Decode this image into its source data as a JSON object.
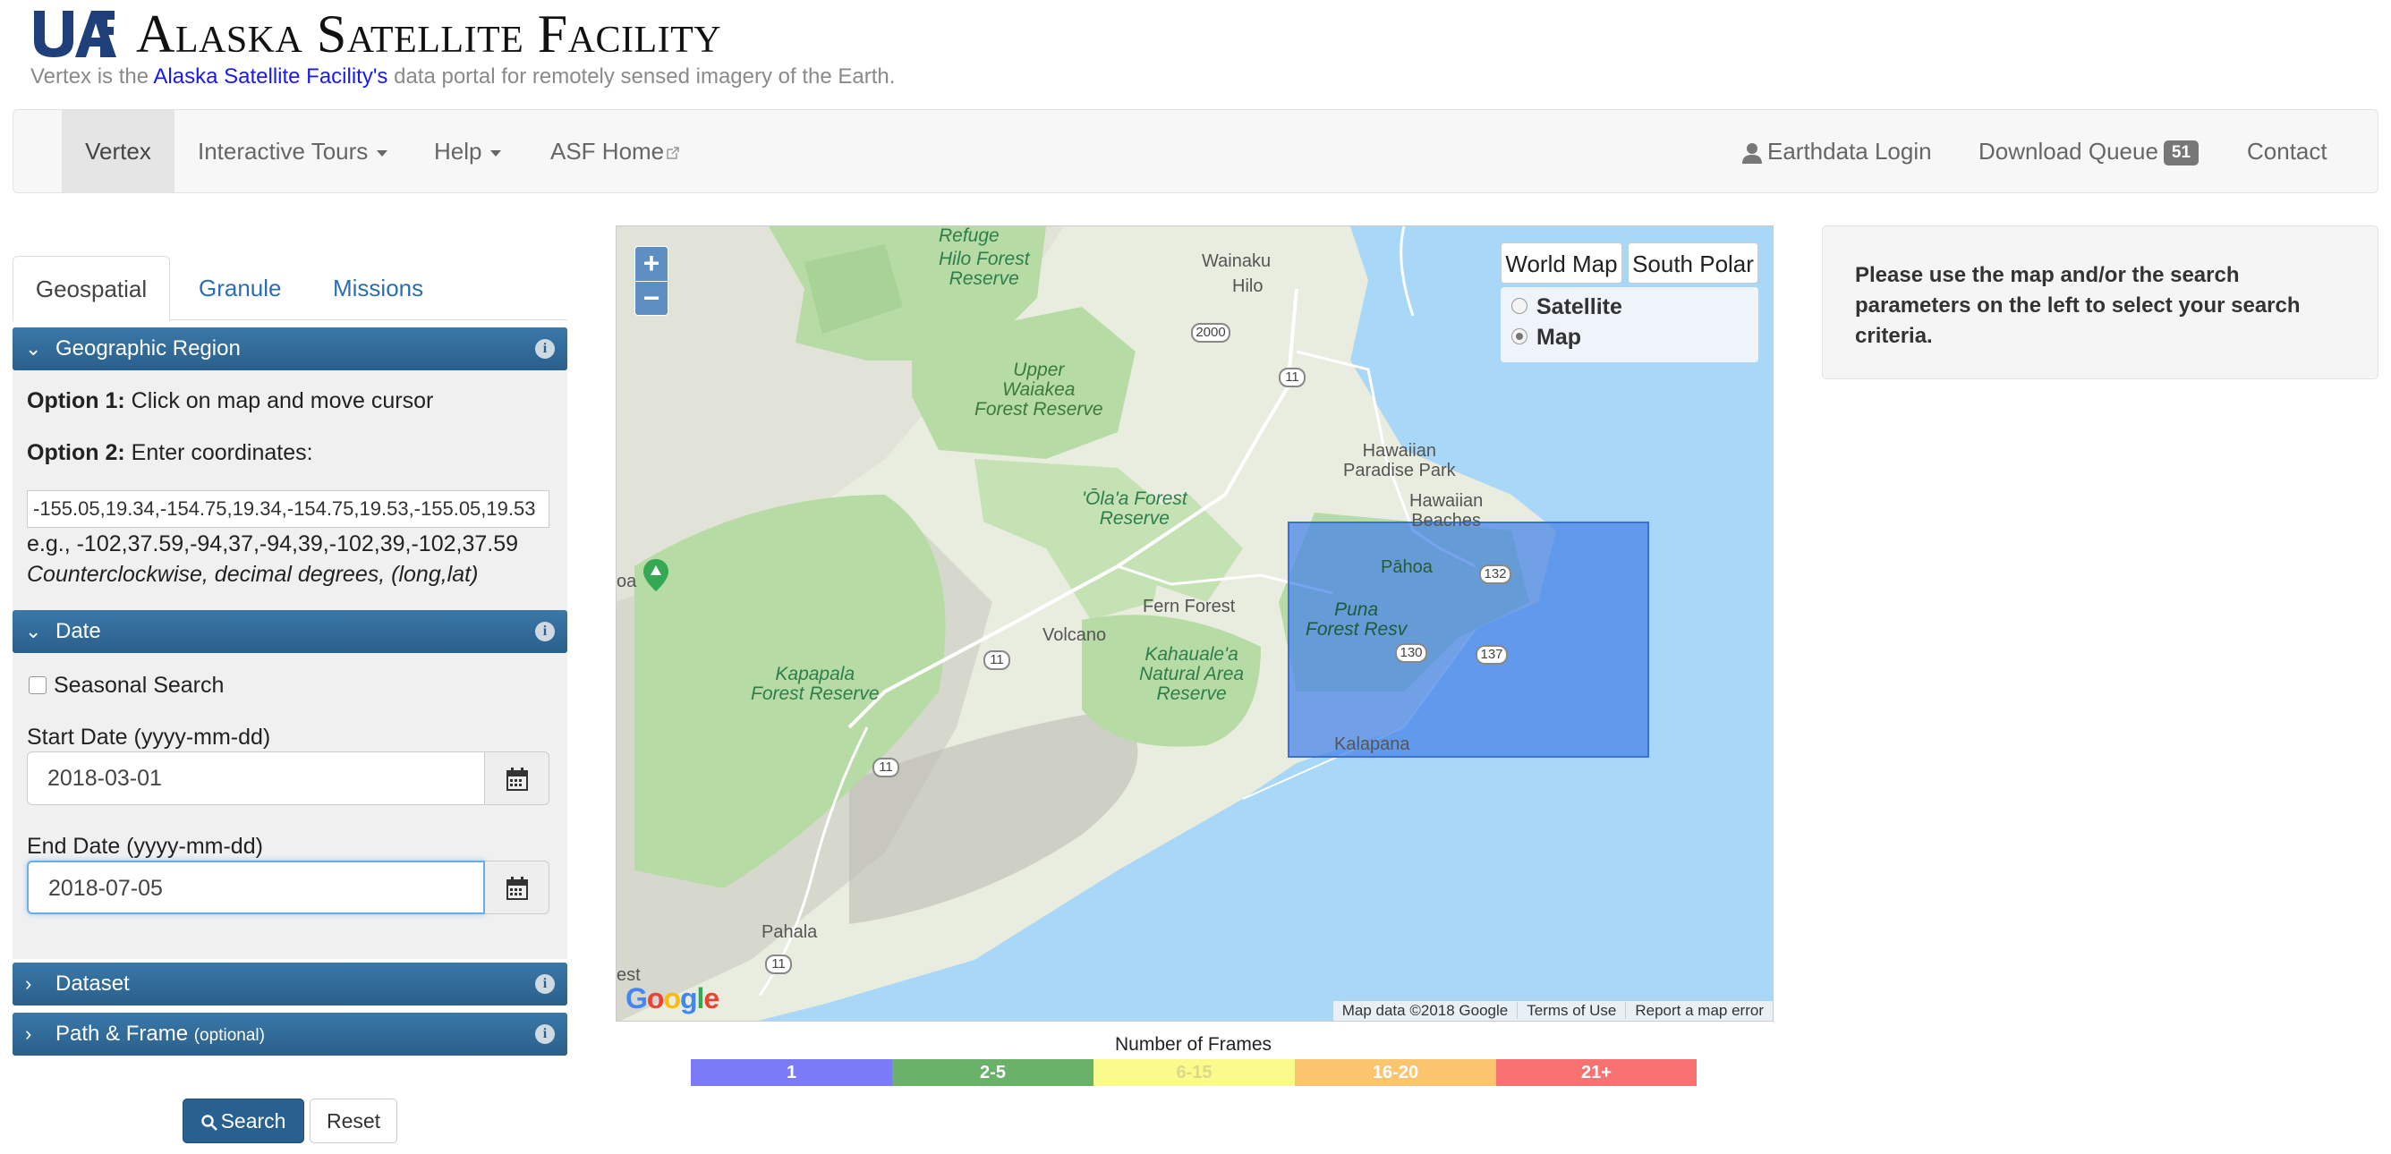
{
  "header": {
    "title": "Alaska Satellite Facility",
    "logo_text": "UAF",
    "tagline_before": "Vertex is the ",
    "tagline_link": "Alaska Satellite Facility's",
    "tagline_after": " data portal for remotely sensed imagery of the Earth."
  },
  "navbar": {
    "vertex": "Vertex",
    "tours": "Interactive Tours",
    "help": "Help",
    "asf_home": "ASF Home",
    "login": "Earthdata Login",
    "queue": "Download Queue",
    "queue_count": "51",
    "contact": "Contact"
  },
  "tabs": [
    "Geospatial",
    "Granule",
    "Missions"
  ],
  "geo": {
    "heading": "Geographic Region",
    "opt1_label": "Option 1:",
    "opt1_text": " Click on map and move cursor",
    "opt2_label": "Option 2:",
    "opt2_text": " Enter coordinates:",
    "coords": "-155.05,19.34,-154.75,19.34,-154.75,19.53,-155.05,19.53",
    "example": "e.g., -102,37.59,-94,37,-94,39,-102,39,-102,37.59",
    "hint": "Counterclockwise, decimal degrees, (long,lat)"
  },
  "date": {
    "heading": "Date",
    "seasonal": "Seasonal Search",
    "start_label": "Start Date (yyyy-mm-dd)",
    "start_value": "2018-03-01",
    "end_label": "End Date (yyyy-mm-dd)",
    "end_value": "2018-07-05"
  },
  "dataset": {
    "heading": "Dataset"
  },
  "path": {
    "heading": "Path & Frame",
    "optional": "(optional)"
  },
  "buttons": {
    "search": "Search",
    "reset": "Reset"
  },
  "map": {
    "world": "World Map",
    "south": "South Polar",
    "satellite": "Satellite",
    "map": "Map",
    "selected": "Map",
    "attrib_data": "Map data ©2018 Google",
    "attrib_terms": "Terms of Use",
    "attrib_report": "Report a map error",
    "google": "Google",
    "places": {
      "refuge": "Refuge",
      "hilo_forest": "Hilo Forest\nReserve",
      "wainaku": "Wainaku",
      "hilo": "Hilo",
      "upper_waiakea": "Upper\nWaiakea\nForest Reserve",
      "hawaiian_paradise": "Hawaiian\nParadise Park",
      "hawaiian_beaches": "Hawaiian\nBeaches",
      "olaa": "'Ōla'a Forest\nReserve",
      "pahoa": "Pāhoa",
      "puna": "Puna\nForest Resv",
      "fern_forest": "Fern Forest",
      "volcano": "Volcano",
      "kahauale": "Kahauale'a\nNatural Area\nReserve",
      "kapapala": "Kapapala\nForest Reserve",
      "kalapana": "Kalapana",
      "pahala": "Pahala",
      "oa": "oa",
      "est": "est"
    },
    "roads": [
      "2000",
      "11",
      "132",
      "130",
      "137",
      "11",
      "11",
      "11"
    ]
  },
  "legend": {
    "title": "Number of Frames",
    "items": [
      {
        "label": "1",
        "color": "#7b7bf7"
      },
      {
        "label": "2-5",
        "color": "#6ab26a"
      },
      {
        "label": "6-15",
        "color": "#fbfb8c"
      },
      {
        "label": "16-20",
        "color": "#fbc46e"
      },
      {
        "label": "21+",
        "color": "#f87272"
      }
    ]
  },
  "info": {
    "message": "Please use the map and/or the search parameters on the left to select your search criteria."
  },
  "colors": {
    "accent": "#2a5f8c",
    "link": "#2a6fb5",
    "water": "#a8d7f7",
    "forest": "#b7dba5",
    "selection": "#4a86e8"
  }
}
